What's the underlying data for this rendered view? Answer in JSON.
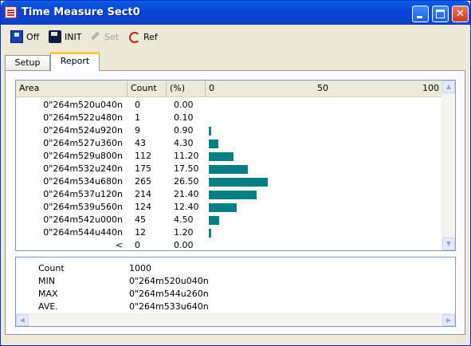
{
  "window": {
    "title": "Time Measure Sect0"
  },
  "icons": {
    "app": "app-icon",
    "minimize": "minimize-icon",
    "maximize": "maximize-icon",
    "close": "close-icon"
  },
  "toolbar": {
    "off_label": "Off",
    "init_label": "INIT",
    "set_label": "Set",
    "ref_label": "Ref"
  },
  "tabs": [
    {
      "label": "Setup",
      "active": false
    },
    {
      "label": "Report",
      "active": true
    }
  ],
  "report": {
    "columns": {
      "area": "Area",
      "count": "Count",
      "pct": "(%)"
    },
    "scale": {
      "min": "0",
      "mid": "50",
      "max": "100"
    },
    "rows": [
      {
        "area": "0\"264m520u040n",
        "count": "0",
        "pct": "0.00",
        "value": 0.0
      },
      {
        "area": "0\"264m522u480n",
        "count": "1",
        "pct": "0.10",
        "value": 0.1
      },
      {
        "area": "0\"264m524u920n",
        "count": "9",
        "pct": "0.90",
        "value": 0.9
      },
      {
        "area": "0\"264m527u360n",
        "count": "43",
        "pct": "4.30",
        "value": 4.3
      },
      {
        "area": "0\"264m529u800n",
        "count": "112",
        "pct": "11.20",
        "value": 11.2
      },
      {
        "area": "0\"264m532u240n",
        "count": "175",
        "pct": "17.50",
        "value": 17.5
      },
      {
        "area": "0\"264m534u680n",
        "count": "265",
        "pct": "26.50",
        "value": 26.5
      },
      {
        "area": "0\"264m537u120n",
        "count": "214",
        "pct": "21.40",
        "value": 21.4
      },
      {
        "area": "0\"264m539u560n",
        "count": "124",
        "pct": "12.40",
        "value": 12.4
      },
      {
        "area": "0\"264m542u000n",
        "count": "45",
        "pct": "4.50",
        "value": 4.5
      },
      {
        "area": "0\"264m544u440n",
        "count": "12",
        "pct": "1.20",
        "value": 1.2
      },
      {
        "area": "<",
        "count": "0",
        "pct": "0.00",
        "value": 0.0
      }
    ]
  },
  "summary": [
    {
      "label": "Count",
      "value": "1000"
    },
    {
      "label": "MIN",
      "value": "0\"264m520u040n"
    },
    {
      "label": "MAX",
      "value": "0\"264m544u260n"
    },
    {
      "label": "AVE.",
      "value": "0\"264m533u640n"
    }
  ],
  "colors": {
    "bar": "#008080",
    "titlebar": "#0845d8",
    "tab_highlight": "#ffc83c"
  }
}
